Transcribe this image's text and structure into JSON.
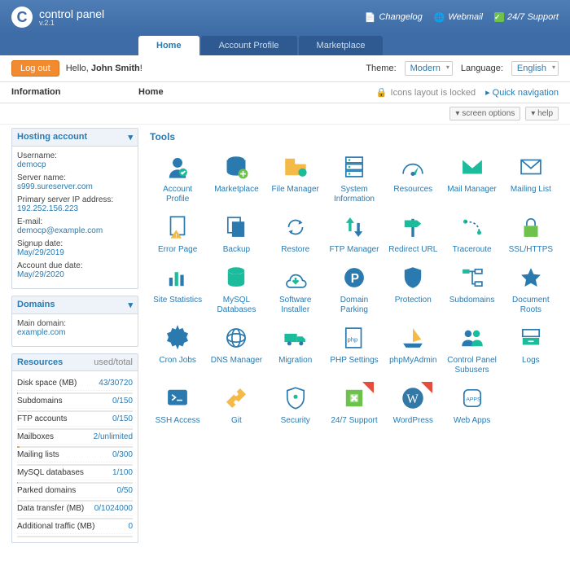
{
  "brand": {
    "name": "control panel",
    "ver": "v.2.1",
    "logo_letter": "C"
  },
  "util": {
    "changelog": "Changelog",
    "webmail": "Webmail",
    "support": "24/7 Support"
  },
  "tabs": [
    "Home",
    "Account Profile",
    "Marketplace"
  ],
  "bar2": {
    "logout": "Log out",
    "hello_pre": "Hello, ",
    "hello_name": "John Smith",
    "hello_post": "!",
    "theme_l": "Theme:",
    "theme_v": "Modern",
    "lang_l": "Language:",
    "lang_v": "English"
  },
  "bar3": {
    "info": "Information",
    "home": "Home",
    "lock": "Icons layout is locked",
    "quick": "Quick navigation",
    "screen": "screen options",
    "help": "help"
  },
  "panels": {
    "hosting": {
      "title": "Hosting account",
      "rows": [
        {
          "k": "Username:",
          "v": "democp"
        },
        {
          "k": "Server name:",
          "v": "s999.sureserver.com"
        },
        {
          "k": "Primary server IP address:",
          "v": "192.252.156.223"
        },
        {
          "k": "E-mail:",
          "v": "democp@example.com"
        },
        {
          "k": "Signup date:",
          "v": "May/29/2019"
        },
        {
          "k": "Account due date:",
          "v": "May/29/2020"
        }
      ]
    },
    "domains": {
      "title": "Domains",
      "rows": [
        {
          "k": "Main domain:",
          "v": "example.com"
        }
      ]
    },
    "resources": {
      "title": "Resources",
      "hdr": "used/total",
      "rows": [
        {
          "k": "Disk space (MB)",
          "v": "43/30720",
          "pct": 1
        },
        {
          "k": "Subdomains",
          "v": "0/150",
          "pct": 0
        },
        {
          "k": "FTP accounts",
          "v": "0/150",
          "pct": 0
        },
        {
          "k": "Mailboxes",
          "v": "2/unlimited",
          "pct": 2
        },
        {
          "k": "Mailing lists",
          "v": "0/300",
          "pct": 0
        },
        {
          "k": "MySQL databases",
          "v": "1/100",
          "pct": 1
        },
        {
          "k": "Parked domains",
          "v": "0/50",
          "pct": 0
        },
        {
          "k": "Data transfer (MB)",
          "v": "0/1024000",
          "pct": 0
        },
        {
          "k": "Additional traffic (MB)",
          "v": "0",
          "pct": 0
        }
      ]
    }
  },
  "tools_h": "Tools",
  "tools": [
    {
      "n": "account-profile",
      "l": "Account Profile",
      "i": "person"
    },
    {
      "n": "marketplace",
      "l": "Marketplace",
      "i": "db-plus"
    },
    {
      "n": "file-manager",
      "l": "File Manager",
      "i": "folder"
    },
    {
      "n": "system-information",
      "l": "System Information",
      "i": "server"
    },
    {
      "n": "resources",
      "l": "Resources",
      "i": "gauge"
    },
    {
      "n": "mail-manager",
      "l": "Mail Manager",
      "i": "envelope"
    },
    {
      "n": "mailing-list",
      "l": "Mailing List",
      "i": "envelope-o"
    },
    {
      "n": "error-page",
      "l": "Error Page",
      "i": "page-warn"
    },
    {
      "n": "backup",
      "l": "Backup",
      "i": "copies"
    },
    {
      "n": "restore",
      "l": "Restore",
      "i": "cycle"
    },
    {
      "n": "ftp-manager",
      "l": "FTP Manager",
      "i": "updown"
    },
    {
      "n": "redirect-url",
      "l": "Redirect URL",
      "i": "sign"
    },
    {
      "n": "traceroute",
      "l": "Traceroute",
      "i": "route"
    },
    {
      "n": "ssl-https",
      "l": "SSL/HTTPS",
      "i": "lock"
    },
    {
      "n": "site-statistics",
      "l": "Site Statistics",
      "i": "bars"
    },
    {
      "n": "mysql-databases",
      "l": "MySQL Databases",
      "i": "db"
    },
    {
      "n": "software-installer",
      "l": "Software Installer",
      "i": "cloud-down"
    },
    {
      "n": "domain-parking",
      "l": "Domain Parking",
      "i": "parking"
    },
    {
      "n": "protection",
      "l": "Protection",
      "i": "shield"
    },
    {
      "n": "subdomains",
      "l": "Subdomains",
      "i": "tree"
    },
    {
      "n": "document-roots",
      "l": "Document Roots",
      "i": "star"
    },
    {
      "n": "cron-jobs",
      "l": "Cron Jobs",
      "i": "gear"
    },
    {
      "n": "dns-manager",
      "l": "DNS Manager",
      "i": "globe"
    },
    {
      "n": "migration",
      "l": "Migration",
      "i": "truck"
    },
    {
      "n": "php-settings",
      "l": "PHP Settings",
      "i": "php"
    },
    {
      "n": "phpmyadmin",
      "l": "phpMyAdmin",
      "i": "boat"
    },
    {
      "n": "control-panel-subusers",
      "l": "Control Panel Subusers",
      "i": "users"
    },
    {
      "n": "logs",
      "l": "Logs",
      "i": "drawer"
    },
    {
      "n": "ssh-access",
      "l": "SSH Access",
      "i": "terminal"
    },
    {
      "n": "git",
      "l": "Git",
      "i": "git"
    },
    {
      "n": "security",
      "l": "Security",
      "i": "shield-o"
    },
    {
      "n": "247-support",
      "l": "24/7 Support",
      "i": "support",
      "new": true
    },
    {
      "n": "wordpress",
      "l": "WordPress",
      "i": "wp",
      "new": true
    },
    {
      "n": "web-apps",
      "l": "Web Apps",
      "i": "apps"
    }
  ]
}
